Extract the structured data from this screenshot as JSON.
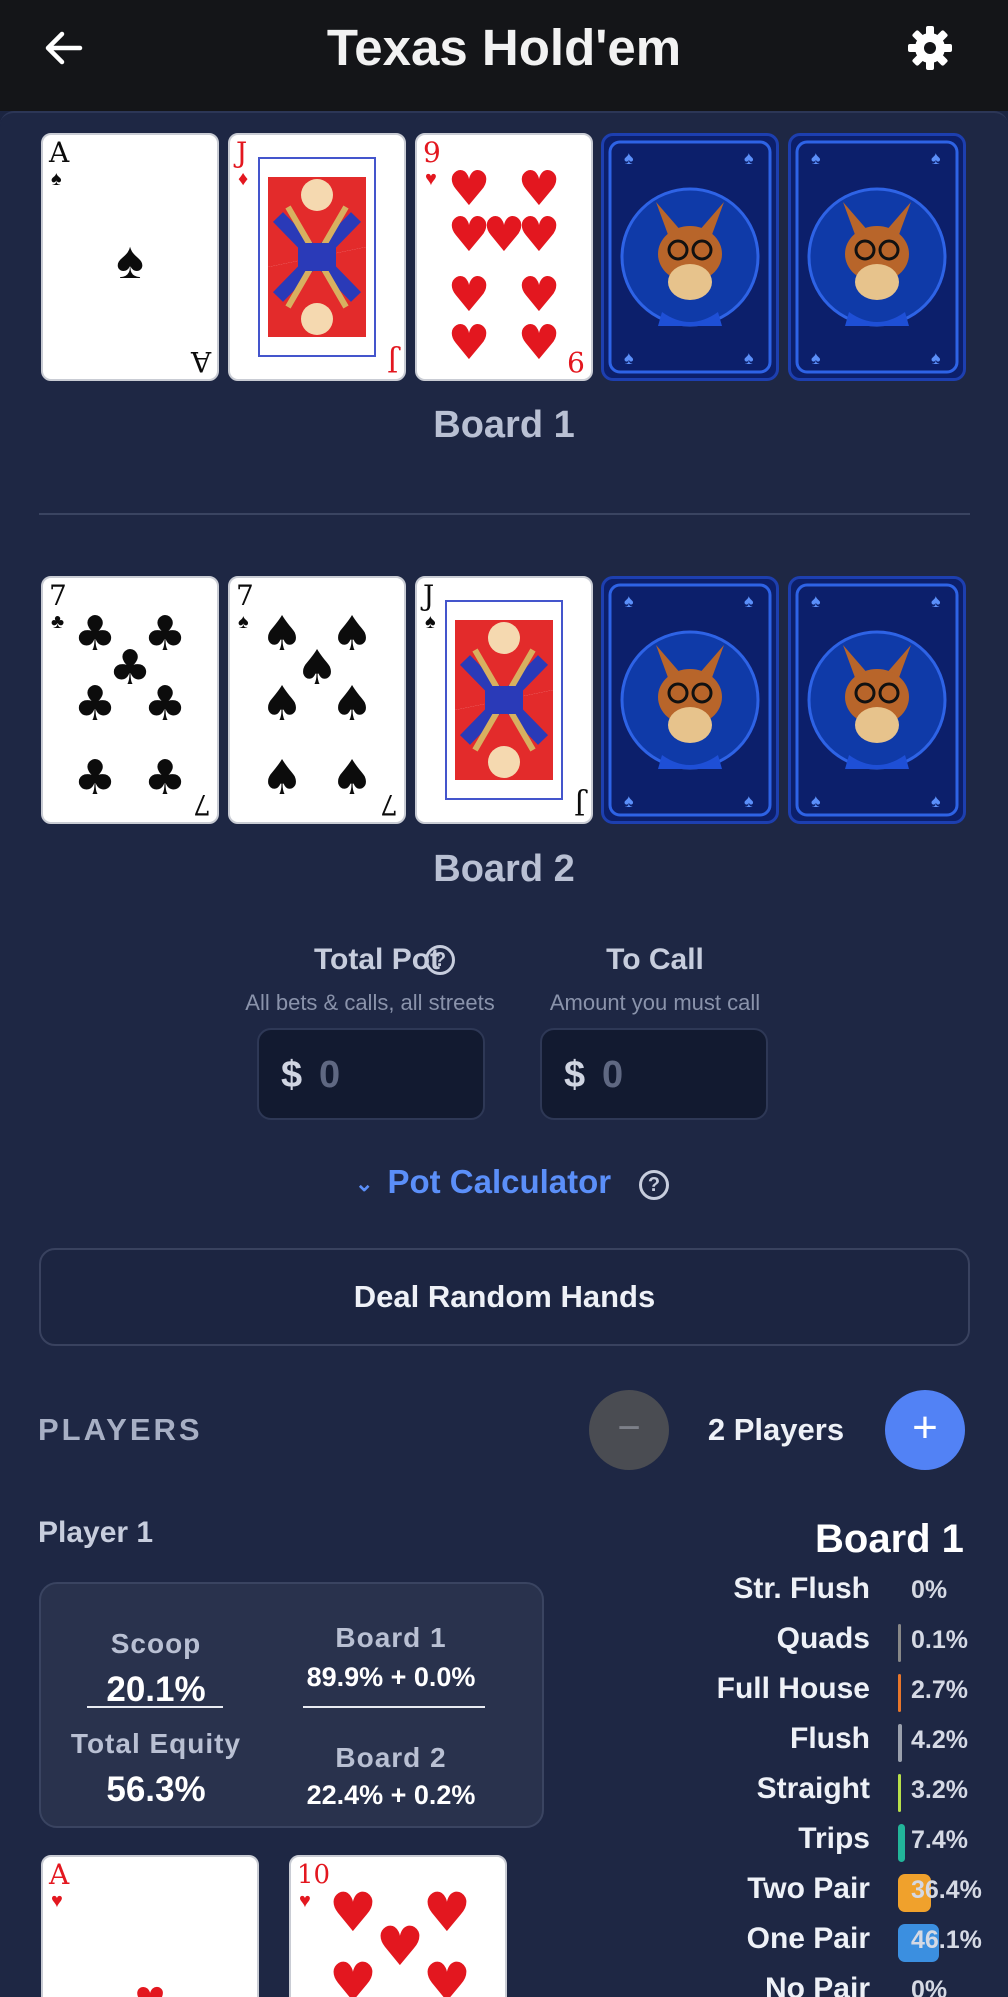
{
  "app": {
    "title": "Texas Hold'em"
  },
  "boards": [
    {
      "label": "Board 1",
      "cards": [
        {
          "rank": "A",
          "suit": "♠",
          "color": "black"
        },
        {
          "rank": "J",
          "suit": "♦",
          "color": "red"
        },
        {
          "rank": "9",
          "suit": "♥",
          "color": "red"
        },
        {
          "rank": "",
          "suit": "",
          "face_down": true
        },
        {
          "rank": "",
          "suit": "",
          "face_down": true
        }
      ]
    },
    {
      "label": "Board 2",
      "cards": [
        {
          "rank": "7",
          "suit": "♣",
          "color": "black"
        },
        {
          "rank": "7",
          "suit": "♠",
          "color": "black"
        },
        {
          "rank": "J",
          "suit": "♠",
          "color": "black"
        },
        {
          "rank": "",
          "suit": "",
          "face_down": true
        },
        {
          "rank": "",
          "suit": "",
          "face_down": true
        }
      ]
    }
  ],
  "pot": {
    "total_pot_label": "Total Pot",
    "total_pot_sub": "All bets & calls, all streets",
    "total_pot_currency": "$",
    "total_pot_placeholder": "0",
    "to_call_label": "To Call",
    "to_call_sub": "Amount you must call",
    "to_call_currency": "$",
    "to_call_placeholder": "0",
    "calculator_label": "Pot Calculator"
  },
  "actions": {
    "deal_label": "Deal Random Hands"
  },
  "players": {
    "section_label": "PLAYERS",
    "count_label": "2 Players",
    "minus_label": "−",
    "plus_label": "+",
    "list": [
      {
        "name": "Player 1",
        "scoop_label": "Scoop",
        "scoop_value": "20.1%",
        "total_equity_label": "Total Equity",
        "total_equity_value": "56.3%",
        "board1_label": "Board 1",
        "board1_value": "89.9% + 0.0%",
        "board2_label": "Board 2",
        "board2_value": "22.4% + 0.2%",
        "hole_cards": [
          {
            "rank": "A",
            "suit": "♥",
            "color": "red"
          },
          {
            "rank": "10",
            "suit": "♥",
            "color": "red"
          }
        ]
      }
    ]
  },
  "hand_stats": {
    "title": "Board 1",
    "rows": [
      {
        "name": "Str. Flush",
        "pct": "0%",
        "value": 0,
        "color": "#888888"
      },
      {
        "name": "Quads",
        "pct": "0.1%",
        "value": 0.1,
        "color": "#888888"
      },
      {
        "name": "Full House",
        "pct": "2.7%",
        "value": 2.7,
        "color": "#e8762b"
      },
      {
        "name": "Flush",
        "pct": "4.2%",
        "value": 4.2,
        "color": "#9aa0ad"
      },
      {
        "name": "Straight",
        "pct": "3.2%",
        "value": 3.2,
        "color": "#b8e04a"
      },
      {
        "name": "Trips",
        "pct": "7.4%",
        "value": 7.4,
        "color": "#22b59a"
      },
      {
        "name": "Two Pair",
        "pct": "36.4%",
        "value": 36.4,
        "color": "#f0a12c"
      },
      {
        "name": "One Pair",
        "pct": "46.1%",
        "value": 46.1,
        "color": "#3b8fe0"
      },
      {
        "name": "No Pair",
        "pct": "0%",
        "value": 0,
        "color": "#888888"
      }
    ]
  },
  "icons": {
    "back": "arrow-left-icon",
    "settings": "gear-icon",
    "help": "question-circle-icon",
    "chevron": "chevron-down-icon"
  }
}
